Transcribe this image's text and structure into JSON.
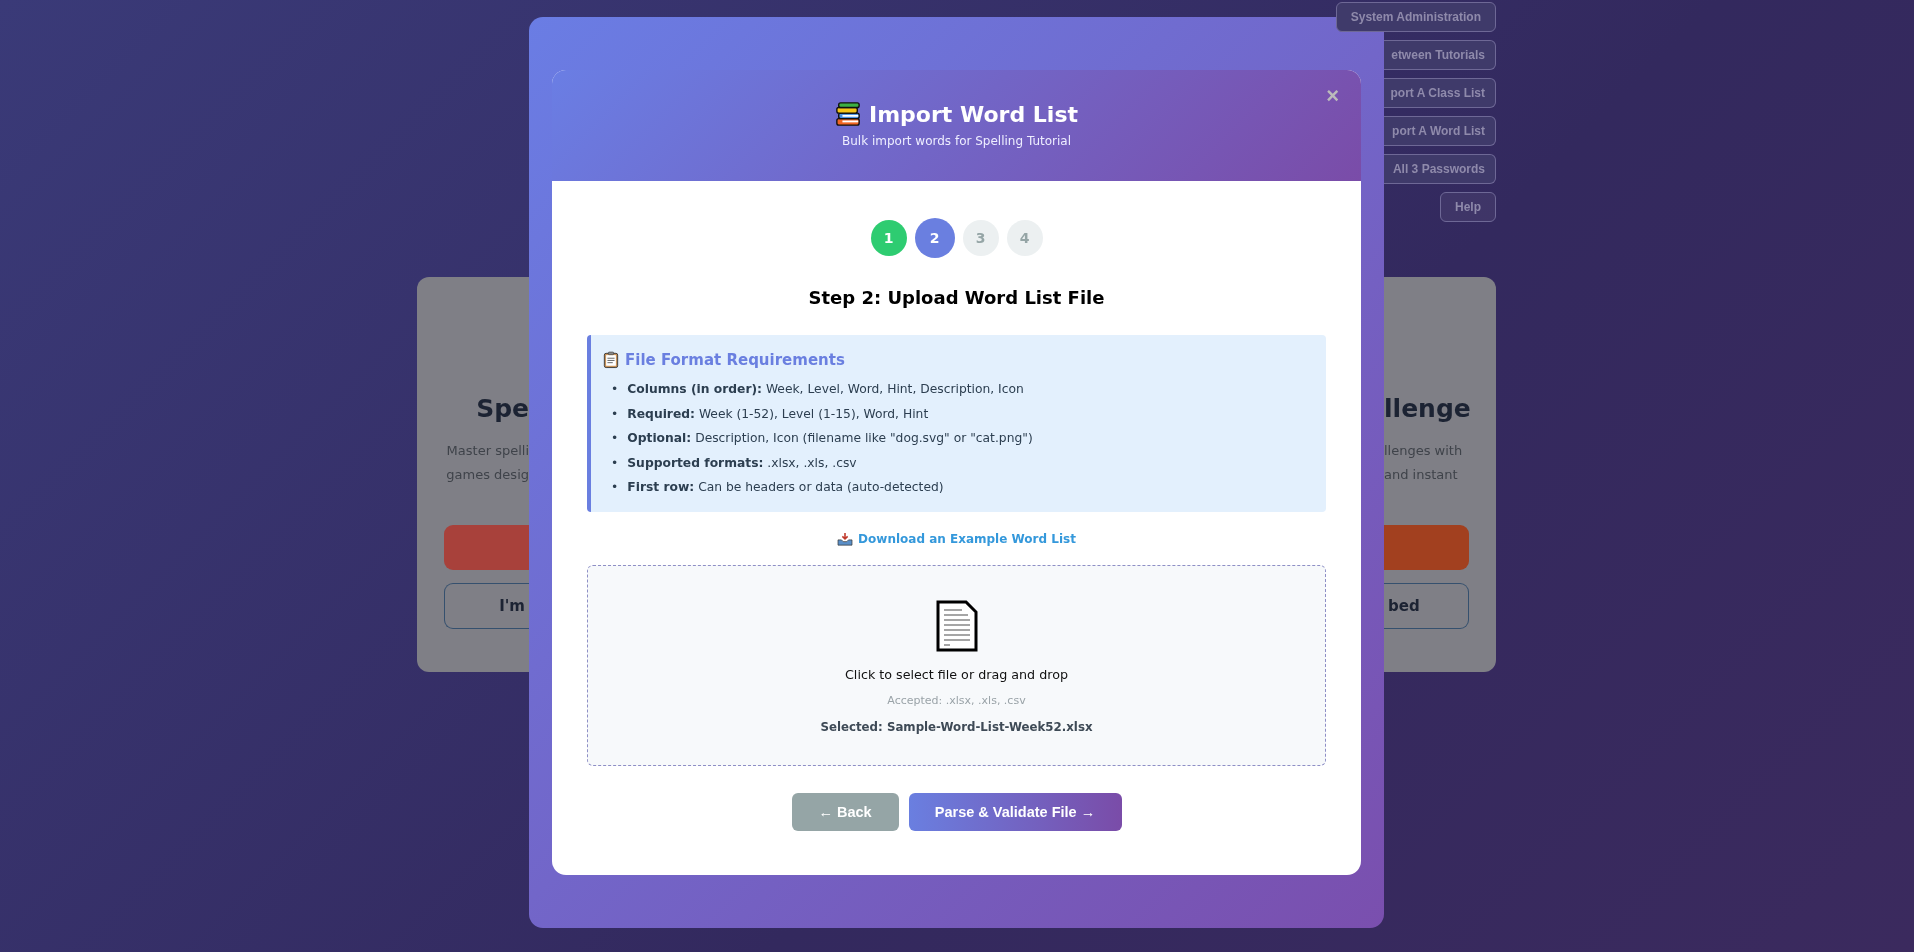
{
  "background": {
    "top_buttons": [
      "System Administration",
      "etween Tutorials",
      "port A Class List",
      "port A Word List",
      "All 3 Passwords",
      "Help"
    ],
    "cards": [
      {
        "title": "Spe",
        "description": [
          "Master spelli",
          "games desig"
        ],
        "color": "#a8413b",
        "secondary_label": "I'm"
      },
      {
        "title": "llenge",
        "description": [
          "llenges with",
          "and instant"
        ],
        "color": "#a2401f",
        "secondary_label": "bed"
      }
    ]
  },
  "modal": {
    "title": "Import Word List",
    "subtitle": "Bulk import words for Spelling Tutorial",
    "close": "×",
    "steps": [
      {
        "label": "1",
        "completed": true,
        "selected": false
      },
      {
        "label": "2",
        "completed": false,
        "selected": true
      },
      {
        "label": "3",
        "completed": false,
        "selected": false
      },
      {
        "label": "4",
        "completed": false,
        "selected": false
      }
    ],
    "step_title": "Step 2: Upload Word List File",
    "requirements": {
      "title": "File Format Requirements",
      "items": [
        {
          "bullet": "•",
          "text": "**Columns (in order):** Week, Level, Word, Hint, Description, Icon"
        },
        {
          "bullet": "•",
          "text": "**Required:** Week (1-52), Level (1-15), Word, Hint"
        },
        {
          "bullet": "•",
          "text": "**Optional:** Description, Icon (filename like \"dog.svg\" or \"cat.png\")"
        },
        {
          "bullet": "•",
          "text": "**Supported formats:** .xlsx, .xls, .csv"
        },
        {
          "bullet": "•",
          "text": "**First row:** Can be headers or data (auto-detected)"
        }
      ]
    },
    "download_link": "Download an Example Word List",
    "dropzone": {
      "prompt": "Click to select file or drag and drop",
      "accepted": "Accepted: .xlsx, .xls, .csv",
      "selected": "Selected: Sample-Word-List-Week52.xlsx"
    },
    "buttons": [
      {
        "label": "← Back",
        "kind": "secondary"
      },
      {
        "label": "Parse & Validate File →",
        "kind": "primary"
      }
    ]
  }
}
